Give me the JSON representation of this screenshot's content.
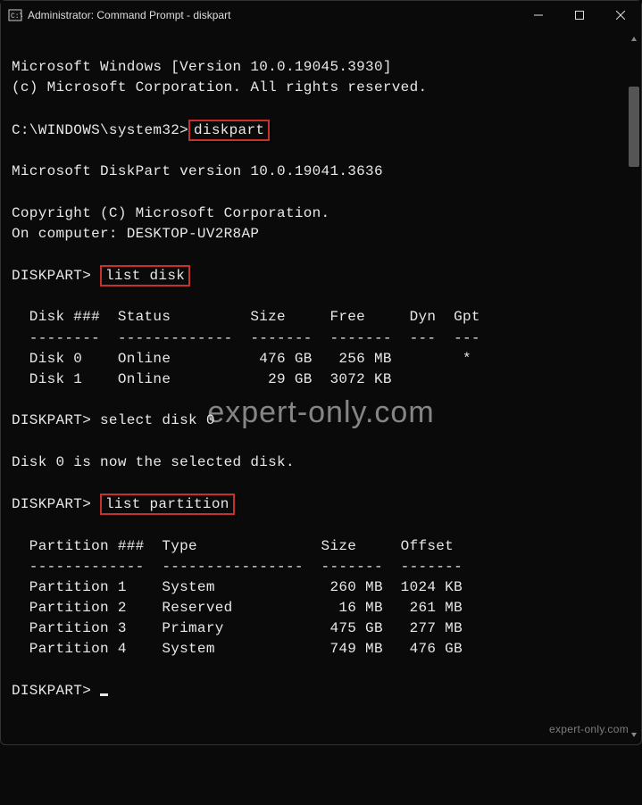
{
  "window": {
    "title": "Administrator: Command Prompt - diskpart"
  },
  "header": {
    "line1": "Microsoft Windows [Version 10.0.19045.3930]",
    "line2": "(c) Microsoft Corporation. All rights reserved."
  },
  "prompt1": {
    "path": "C:\\WINDOWS\\system32>",
    "cmd": "diskpart"
  },
  "diskpart_banner": {
    "line1": "Microsoft DiskPart version 10.0.19041.3636",
    "line2": "Copyright (C) Microsoft Corporation.",
    "line3": "On computer: DESKTOP-UV2R8AP"
  },
  "prompt2": {
    "path": "DISKPART> ",
    "cmd": "list disk"
  },
  "disk_table": {
    "header": "  Disk ###  Status         Size     Free     Dyn  Gpt",
    "divider": "  --------  -------------  -------  -------  ---  ---",
    "rows": [
      "  Disk 0    Online          476 GB   256 MB        *",
      "  Disk 1    Online           29 GB  3072 KB"
    ]
  },
  "prompt3": {
    "path": "DISKPART> ",
    "cmd": "select disk 0"
  },
  "select_result": "Disk 0 is now the selected disk.",
  "prompt4": {
    "path": "DISKPART> ",
    "cmd": "list partition"
  },
  "part_table": {
    "header": "  Partition ###  Type              Size     Offset",
    "divider": "  -------------  ----------------  -------  -------",
    "rows": [
      "  Partition 1    System             260 MB  1024 KB",
      "  Partition 2    Reserved            16 MB   261 MB",
      "  Partition 3    Primary            475 GB   277 MB",
      "  Partition 4    System             749 MB   476 GB"
    ]
  },
  "prompt5": {
    "path": "DISKPART> "
  },
  "watermark": "expert-only.com",
  "watermark_small": "expert-only.com"
}
